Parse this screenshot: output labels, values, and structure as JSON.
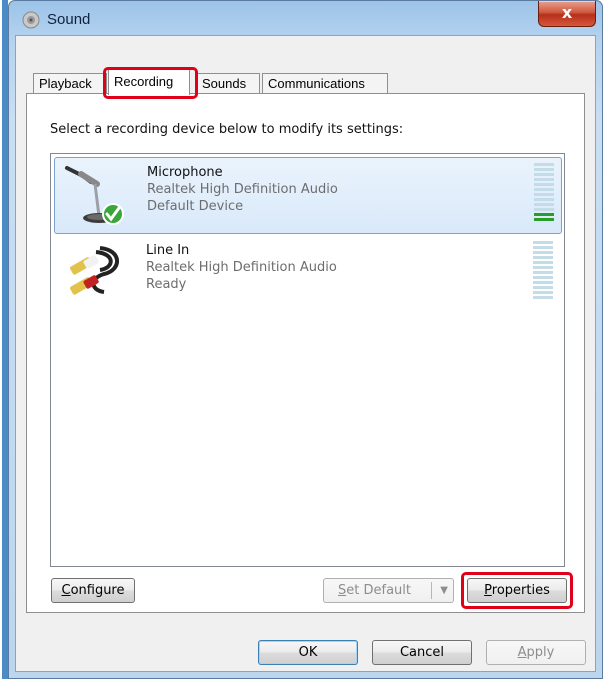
{
  "window": {
    "title": "Sound",
    "close_label": "x"
  },
  "tabs": [
    {
      "label": "Playback"
    },
    {
      "label": "Recording"
    },
    {
      "label": "Sounds"
    },
    {
      "label": "Communications"
    }
  ],
  "panel": {
    "instruction": "Select a recording device below to modify its settings:"
  },
  "devices": [
    {
      "name": "Microphone",
      "driver": "Realtek High Definition Audio",
      "status": "Default Device",
      "icon": "microphone-icon",
      "level_fraction": 0.2
    },
    {
      "name": "Line In",
      "driver": "Realtek High Definition Audio",
      "status": "Ready",
      "icon": "rca-cable-icon",
      "level_fraction": 0
    }
  ],
  "buttons": {
    "configure": {
      "accel": "C",
      "rest": "onfigure"
    },
    "set_default": {
      "accel": "S",
      "rest": "et Default"
    },
    "properties": {
      "accel": "P",
      "rest": "roperties"
    },
    "ok": "OK",
    "cancel": "Cancel",
    "apply": {
      "accel": "A",
      "rest": "pply"
    }
  },
  "colors": {
    "highlight_box": "#e0001a",
    "meter_active": "#2a9c2a",
    "close_button": "#c9452a"
  }
}
